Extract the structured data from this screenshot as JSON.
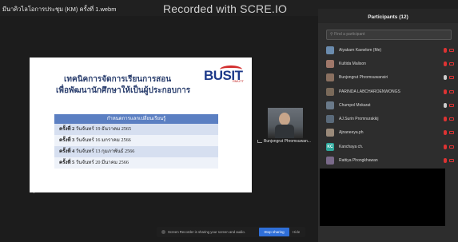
{
  "window": {
    "video_title": "มีนาคิวไลโอการประชุม (KM) ครั้งที่ 1.webm",
    "recorded_text": "Recorded with SCRE.IO"
  },
  "slide": {
    "heading_line1": "เทคนิคการจัดการเรียนการสอน",
    "heading_line2": "เพื่อพัฒนานักศึกษาให้เป็นผู้ประกอบการ",
    "logo_text": "BUSIT",
    "logo_sub": "RMUTT",
    "table_header": "กำหนดการแลกเปลี่ยนเรียนรู้",
    "rows": [
      {
        "label": "ครั้งที่ 2",
        "date": "วันจันทร์ 19 ธันวาคม 2565"
      },
      {
        "label": "ครั้งที่ 3",
        "date": "วันจันทร์ 16 มกราคม 2566"
      },
      {
        "label": "ครั้งที่ 4",
        "date": "วันจันทร์ 13 กุมภาพันธ์ 2566"
      },
      {
        "label": "ครั้งที่ 5",
        "date": "วันจันทร์ 20 มีนาคม 2566"
      }
    ]
  },
  "speaker": {
    "name": "Bunjongrut Phromsuwan..."
  },
  "participants": {
    "title": "Participants (12)",
    "search_placeholder": "Find a participant",
    "items": [
      {
        "name": "Aiyakarn Kaewlom (Me)",
        "avatar_color": "#6b8cae",
        "initials": ""
      },
      {
        "name": "Kultida Malison",
        "avatar_color": "#a0786a",
        "initials": ""
      },
      {
        "name": "Bunjongrut Phromsuwansiri",
        "avatar_color": "#8a7060",
        "initials": ""
      },
      {
        "name": "PARINDA LABCHAROENWONGS",
        "avatar_color": "#7a6a5a",
        "initials": ""
      },
      {
        "name": "Chumpol Mokarat",
        "avatar_color": "#6a7a8a",
        "initials": ""
      },
      {
        "name": "AJ.Surin Promnurakkij",
        "avatar_color": "#5a6a7a",
        "initials": ""
      },
      {
        "name": "Ajnaneeya.ph",
        "avatar_color": "#9a8a7a",
        "initials": ""
      },
      {
        "name": "Kanchaya ch.",
        "avatar_color": "#2ea89c",
        "initials": "KC"
      },
      {
        "name": "Rattiya Phongkhawan",
        "avatar_color": "#7a6a8a",
        "initials": ""
      }
    ]
  },
  "share_bar": {
    "text": "Screen Recorder is sharing your screen and audio.",
    "stop_label": "Stop sharing",
    "hide_label": "Hide"
  }
}
